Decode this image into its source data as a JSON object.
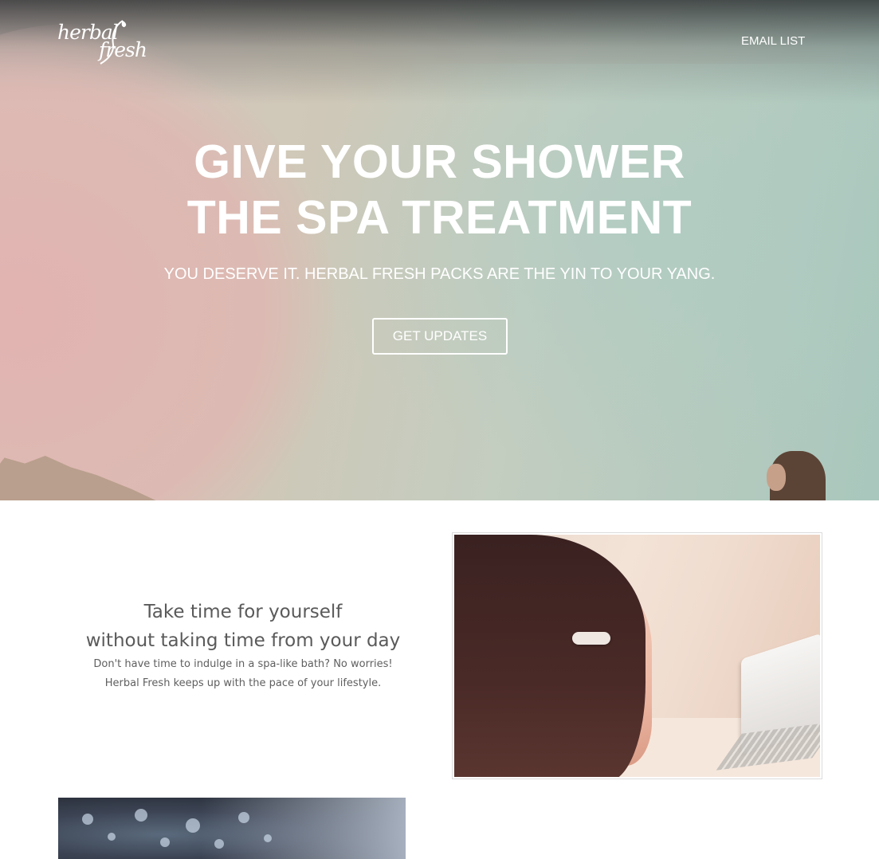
{
  "brand": {
    "logo_line1": "herbal",
    "logo_line2": "fresh"
  },
  "nav": {
    "email_list": "EMAIL LIST"
  },
  "hero": {
    "title_line1": "GIVE YOUR SHOWER",
    "title_line2": "THE SPA TREATMENT",
    "subtitle": "YOU DESERVE IT. HERBAL FRESH PACKS ARE THE YIN TO YOUR YANG.",
    "cta_label": "GET UPDATES"
  },
  "feature": {
    "heading_line1": "Take time for yourself",
    "heading_line2": "without taking time from your day",
    "body_line1": "Don't have time to indulge in a spa-like bath? No worries!",
    "body_line2": "Herbal Fresh keeps up with the pace of your lifestyle."
  },
  "colors": {
    "text_light": "#ffffff",
    "text_dark": "#5a5a5a"
  }
}
